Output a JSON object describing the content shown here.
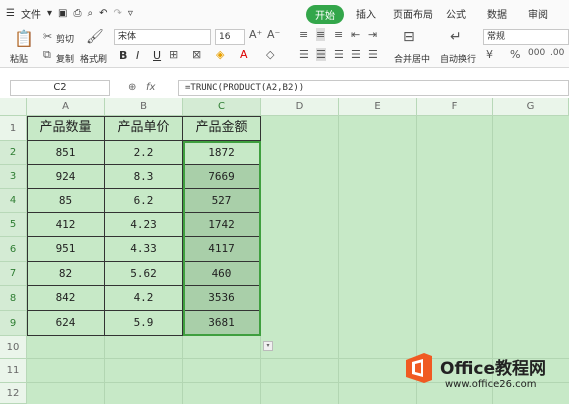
{
  "menubar": {
    "file_label": "文件",
    "tabs": [
      "开始",
      "插入",
      "页面布局",
      "公式",
      "数据",
      "审阅"
    ]
  },
  "ribbon": {
    "paste": "粘贴",
    "cut": "剪切",
    "copy": "复制",
    "format_painter": "格式刷",
    "font_name": "宋体",
    "font_size": "16",
    "bold": "B",
    "italic": "I",
    "underline": "U",
    "merge_center": "合并居中",
    "auto_wrap": "自动换行",
    "number_format": "常规"
  },
  "formula_bar": {
    "name_box": "C2",
    "fx": "fx",
    "formula": "=TRUNC(PRODUCT(A2,B2))"
  },
  "sheet": {
    "columns": [
      "A",
      "B",
      "C",
      "D",
      "E",
      "F",
      "G"
    ],
    "rows": [
      "1",
      "2",
      "3",
      "4",
      "5",
      "6",
      "7",
      "8",
      "9",
      "10",
      "11",
      "12"
    ],
    "headers": [
      "产品数量",
      "产品单价",
      "产品金额"
    ],
    "data": [
      [
        "851",
        "2.2",
        "1872"
      ],
      [
        "924",
        "8.3",
        "7669"
      ],
      [
        "85",
        "6.2",
        "527"
      ],
      [
        "412",
        "4.23",
        "1742"
      ],
      [
        "951",
        "4.33",
        "4117"
      ],
      [
        "82",
        "5.62",
        "460"
      ],
      [
        "842",
        "4.2",
        "3536"
      ],
      [
        "624",
        "5.9",
        "3681"
      ]
    ]
  },
  "watermark": {
    "title": "Office教程网",
    "url": "www.office26.com",
    "accent": "#f05a22"
  }
}
